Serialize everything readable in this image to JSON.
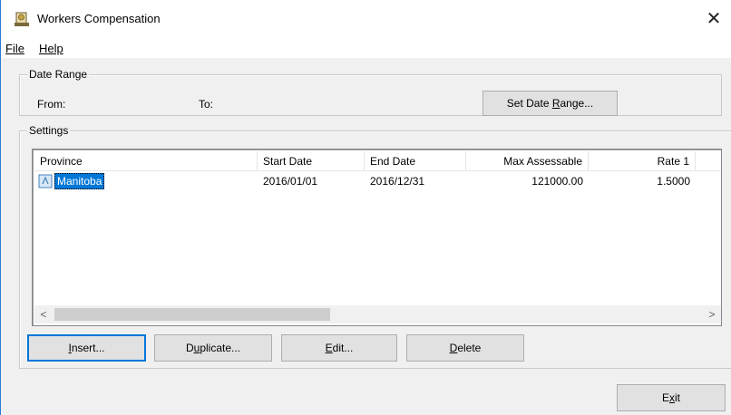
{
  "window": {
    "title": "Workers Compensation",
    "close_glyph": "✕"
  },
  "menu": {
    "file": "File",
    "help": "Help"
  },
  "date_range": {
    "legend": "Date Range",
    "from_label": "From:",
    "to_label": "To:",
    "set_button_prefix": "Set Date ",
    "set_button_accel": "R",
    "set_button_suffix": "ange..."
  },
  "settings": {
    "legend": "Settings",
    "columns": [
      "Province",
      "Start Date",
      "End Date",
      "Max Assessable",
      "Rate 1"
    ],
    "rows": [
      {
        "province": "Manitoba",
        "start_date": "2016/01/01",
        "end_date": "2016/12/31",
        "max_assessable": "121000.00",
        "rate1": "1.5000",
        "selected": true
      }
    ],
    "scroll_left_glyph": "<",
    "scroll_right_glyph": ">"
  },
  "buttons": {
    "insert_accel": "I",
    "insert_rest": "nsert...",
    "duplicate_pre": "D",
    "duplicate_accel": "u",
    "duplicate_rest": "plicate...",
    "edit_accel": "E",
    "edit_rest": "dit...",
    "delete_accel": "D",
    "delete_rest": "elete",
    "exit_pre": "E",
    "exit_accel": "x",
    "exit_rest": "it"
  },
  "icons": {
    "title_icon": "workers-comp-app-icon",
    "row_icon": "record-icon",
    "accent": "#0078d7"
  }
}
